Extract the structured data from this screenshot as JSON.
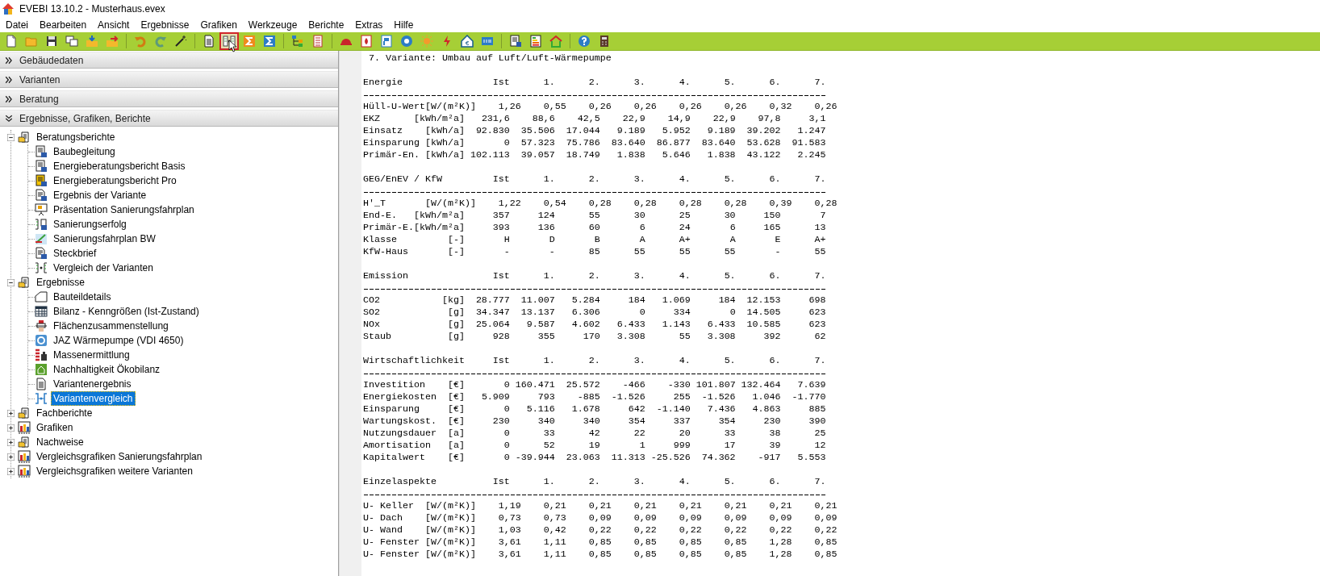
{
  "window": {
    "title": "EVEBI 13.10.2 - Musterhaus.evex"
  },
  "menu": [
    "Datei",
    "Bearbeiten",
    "Ansicht",
    "Ergebnisse",
    "Grafiken",
    "Werkzeuge",
    "Berichte",
    "Extras",
    "Hilfe"
  ],
  "toolbar": [
    {
      "kind": "new",
      "selected": false
    },
    {
      "kind": "open",
      "selected": false
    },
    {
      "kind": "save",
      "selected": false
    },
    {
      "kind": "copy",
      "selected": false
    },
    {
      "kind": "import",
      "selected": false
    },
    {
      "kind": "export",
      "selected": false
    },
    {
      "kind": "sep"
    },
    {
      "kind": "undo",
      "selected": false
    },
    {
      "kind": "redo",
      "selected": false
    },
    {
      "kind": "wand",
      "selected": false
    },
    {
      "kind": "sep"
    },
    {
      "kind": "document",
      "selected": false
    },
    {
      "kind": "compare",
      "selected": true
    },
    {
      "kind": "sigma-orange",
      "selected": false
    },
    {
      "kind": "sigma-blue",
      "selected": false
    },
    {
      "kind": "sep"
    },
    {
      "kind": "tree",
      "selected": false
    },
    {
      "kind": "list",
      "selected": false
    },
    {
      "kind": "sep"
    },
    {
      "kind": "cap",
      "selected": false
    },
    {
      "kind": "flame",
      "selected": false
    },
    {
      "kind": "panel",
      "selected": false
    },
    {
      "kind": "circle",
      "selected": false
    },
    {
      "kind": "sun",
      "selected": false
    },
    {
      "kind": "bolt",
      "selected": false
    },
    {
      "kind": "house-euro",
      "selected": false
    },
    {
      "kind": "box",
      "selected": false
    },
    {
      "kind": "sep"
    },
    {
      "kind": "report",
      "selected": false
    },
    {
      "kind": "energy-label",
      "selected": false
    },
    {
      "kind": "house",
      "selected": false
    },
    {
      "kind": "sep"
    },
    {
      "kind": "help",
      "selected": false
    },
    {
      "kind": "calculator",
      "selected": false
    }
  ],
  "panels": [
    {
      "title": "Gebäudedaten",
      "expanded": false
    },
    {
      "title": "Varianten",
      "expanded": false
    },
    {
      "title": "Beratung",
      "expanded": false
    },
    {
      "title": "Ergebnisse, Grafiken, Berichte",
      "expanded": true
    }
  ],
  "tree": [
    {
      "label": "Beratungsberichte",
      "kind": "report-folder",
      "expanded": true,
      "selected": false,
      "children": [
        {
          "label": "Baubegleitung",
          "kind": "word-report",
          "selected": false
        },
        {
          "label": "Energieberatungsbericht Basis",
          "kind": "word-report",
          "selected": false
        },
        {
          "label": "Energieberatungsbericht Pro",
          "kind": "word-report-pro",
          "selected": false
        },
        {
          "label": "Ergebnis der Variante",
          "kind": "text-report",
          "selected": false
        },
        {
          "label": "Präsentation Sanierungsfahrplan",
          "kind": "presentation",
          "selected": false
        },
        {
          "label": "Sanierungserfolg",
          "kind": "compare-report",
          "selected": false
        },
        {
          "label": "Sanierungsfahrplan BW",
          "kind": "roadmap",
          "selected": false
        },
        {
          "label": "Steckbrief",
          "kind": "text-report",
          "selected": false
        },
        {
          "label": "Vergleich der Varianten",
          "kind": "compare",
          "selected": false
        }
      ]
    },
    {
      "label": "Ergebnisse",
      "kind": "report-folder",
      "expanded": true,
      "selected": false,
      "children": [
        {
          "label": "Bauteildetails",
          "kind": "house-outline",
          "selected": false
        },
        {
          "label": "Bilanz - Kenngrößen (Ist-Zustand)",
          "kind": "grid-table",
          "selected": false
        },
        {
          "label": "Flächenzusammenstellung",
          "kind": "area",
          "selected": false
        },
        {
          "label": "JAZ Wärmepumpe (VDI 4650)",
          "kind": "gauge",
          "selected": false
        },
        {
          "label": "Massenermittlung",
          "kind": "masses",
          "selected": false
        },
        {
          "label": "Nachhaltigkeit Ökobilanz",
          "kind": "eco",
          "selected": false
        },
        {
          "label": "Variantenergebnis",
          "kind": "document",
          "selected": false
        },
        {
          "label": "Variantenvergleich",
          "kind": "compare-blue",
          "selected": true
        }
      ]
    },
    {
      "label": "Fachberichte",
      "kind": "report-folder",
      "expanded": false,
      "selected": false
    },
    {
      "label": "Grafiken",
      "kind": "chart-folder",
      "expanded": false,
      "selected": false
    },
    {
      "label": "Nachweise",
      "kind": "report-folder",
      "expanded": false,
      "selected": false
    },
    {
      "label": "Vergleichsgrafiken Sanierungsfahrplan",
      "kind": "chart-folder",
      "expanded": false,
      "selected": false
    },
    {
      "label": "Vergleichsgrafiken weitere Varianten",
      "kind": "chart-folder",
      "expanded": false,
      "selected": false
    }
  ],
  "report": {
    "title": "7. Variante: Umbau auf Luft/Luft-Wärmepumpe",
    "sections": [
      {
        "title": "Energie",
        "columns": [
          "Ist",
          "1.",
          "2.",
          "3.",
          "4.",
          "5.",
          "6.",
          "7."
        ],
        "rows": [
          {
            "label": "Hüll-U-Wert",
            "unit": "[W/(m²K)]",
            "kind": "decimal",
            "values": [
              "1,26",
              "0,55",
              "0,26",
              "0,26",
              "0,26",
              "0,26",
              "0,32",
              "0,26"
            ]
          },
          {
            "label": "EKZ",
            "unit": "[kWh/m²a]",
            "kind": "standard",
            "values": [
              "231,6",
              "88,6",
              "42,5",
              "22,9",
              "14,9",
              "22,9",
              "97,8",
              "3,1"
            ]
          },
          {
            "label": "Einsatz",
            "unit": "[kWh/a]",
            "kind": "standard",
            "values": [
              "92.830",
              "35.506",
              "17.044",
              "9.189",
              "5.952",
              "9.189",
              "39.202",
              "1.247"
            ]
          },
          {
            "label": "Einsparung",
            "unit": "[kWh/a]",
            "kind": "standard",
            "values": [
              "0",
              "57.323",
              "75.786",
              "83.640",
              "86.877",
              "83.640",
              "53.628",
              "91.583"
            ]
          },
          {
            "label": "Primär-En.",
            "unit": "[kWh/a]",
            "kind": "standard",
            "values": [
              "102.113",
              "39.057",
              "18.749",
              "1.838",
              "5.646",
              "1.838",
              "43.122",
              "2.245"
            ]
          }
        ]
      },
      {
        "title": "GEG/EnEV / KfW",
        "columns": [
          "Ist",
          "1.",
          "2.",
          "3.",
          "4.",
          "5.",
          "6.",
          "7."
        ],
        "rows": [
          {
            "label": "H'_T",
            "unit": "[W/(m²K)]",
            "kind": "decimal",
            "values": [
              "1,22",
              "0,54",
              "0,28",
              "0,28",
              "0,28",
              "0,28",
              "0,39",
              "0,28"
            ]
          },
          {
            "label": "End-E.",
            "unit": "[kWh/m²a]",
            "kind": "standard",
            "values": [
              "357",
              "124",
              "55",
              "30",
              "25",
              "30",
              "150",
              "7"
            ]
          },
          {
            "label": "Primär-E.",
            "unit": "[kWh/m²a]",
            "kind": "standard",
            "values": [
              "393",
              "136",
              "60",
              "6",
              "24",
              "6",
              "165",
              "13"
            ]
          },
          {
            "label": "Klasse",
            "unit": "[-]",
            "kind": "standard",
            "values": [
              "H",
              "D",
              "B",
              "A",
              "A+",
              "A",
              "E",
              "A+"
            ]
          },
          {
            "label": "KfW-Haus",
            "unit": "[-]",
            "kind": "standard",
            "values": [
              "-",
              "-",
              "85",
              "55",
              "55",
              "55",
              "-",
              "55"
            ]
          }
        ]
      },
      {
        "title": "Emission",
        "columns": [
          "Ist",
          "1.",
          "2.",
          "3.",
          "4.",
          "5.",
          "6.",
          "7."
        ],
        "rows": [
          {
            "label": "CO2",
            "unit": "[kg]",
            "kind": "standard",
            "values": [
              "28.777",
              "11.007",
              "5.284",
              "184",
              "1.069",
              "184",
              "12.153",
              "698"
            ]
          },
          {
            "label": "SO2",
            "unit": "[g]",
            "kind": "standard",
            "values": [
              "34.347",
              "13.137",
              "6.306",
              "0",
              "334",
              "0",
              "14.505",
              "623"
            ]
          },
          {
            "label": "NOx",
            "unit": "[g]",
            "kind": "standard",
            "values": [
              "25.064",
              "9.587",
              "4.602",
              "6.433",
              "1.143",
              "6.433",
              "10.585",
              "623"
            ]
          },
          {
            "label": "Staub",
            "unit": "[g]",
            "kind": "standard",
            "values": [
              "928",
              "355",
              "170",
              "3.308",
              "55",
              "3.308",
              "392",
              "62"
            ]
          }
        ]
      },
      {
        "title": "Wirtschaftlichkeit",
        "columns": [
          "Ist",
          "1.",
          "2.",
          "3.",
          "4.",
          "5.",
          "6.",
          "7."
        ],
        "rows": [
          {
            "label": "Investition",
            "unit": "[€]",
            "kind": "standard",
            "values": [
              "0",
              "160.471",
              "25.572",
              "-466",
              "-330",
              "101.807",
              "132.464",
              "7.639"
            ]
          },
          {
            "label": "Energiekosten",
            "unit": "[€]",
            "kind": "standard",
            "values": [
              "5.909",
              "793",
              "-885",
              "-1.526",
              "255",
              "-1.526",
              "1.046",
              "-1.770"
            ]
          },
          {
            "label": "Einsparung",
            "unit": "[€]",
            "kind": "standard",
            "values": [
              "0",
              "5.116",
              "1.678",
              "642",
              "-1.140",
              "7.436",
              "4.863",
              "885"
            ]
          },
          {
            "label": "Wartungskost.",
            "unit": "[€]",
            "kind": "standard",
            "values": [
              "230",
              "340",
              "340",
              "354",
              "337",
              "354",
              "230",
              "390"
            ]
          },
          {
            "label": "Nutzungsdauer",
            "unit": "[a]",
            "kind": "standard",
            "values": [
              "0",
              "33",
              "42",
              "22",
              "20",
              "33",
              "38",
              "25"
            ]
          },
          {
            "label": "Amortisation",
            "unit": "[a]",
            "kind": "standard",
            "values": [
              "0",
              "52",
              "19",
              "1",
              "999",
              "17",
              "39",
              "12"
            ]
          },
          {
            "label": "Kapitalwert",
            "unit": "[€]",
            "kind": "standard",
            "values": [
              "0",
              "-39.944",
              "23.063",
              "11.313",
              "-25.526",
              "74.362",
              "-917",
              "5.553"
            ]
          }
        ]
      },
      {
        "title": "Einzelaspekte",
        "columns": [
          "Ist",
          "1.",
          "2.",
          "3.",
          "4.",
          "5.",
          "6.",
          "7."
        ],
        "rows": [
          {
            "label": "U- Keller",
            "unit": "[W/(m²K)]",
            "kind": "decimal",
            "values": [
              "1,19",
              "0,21",
              "0,21",
              "0,21",
              "0,21",
              "0,21",
              "0,21",
              "0,21"
            ]
          },
          {
            "label": "U- Dach",
            "unit": "[W/(m²K)]",
            "kind": "decimal",
            "values": [
              "0,73",
              "0,73",
              "0,09",
              "0,09",
              "0,09",
              "0,09",
              "0,09",
              "0,09"
            ]
          },
          {
            "label": "U- Wand",
            "unit": "[W/(m²K)]",
            "kind": "decimal",
            "values": [
              "1,03",
              "0,42",
              "0,22",
              "0,22",
              "0,22",
              "0,22",
              "0,22",
              "0,22"
            ]
          },
          {
            "label": "U- Fenster",
            "unit": "[W/(m²K)]",
            "kind": "decimal",
            "values": [
              "3,61",
              "1,11",
              "0,85",
              "0,85",
              "0,85",
              "0,85",
              "1,28",
              "0,85"
            ]
          },
          {
            "label": "U- Fenster",
            "unit": "[W/(m²K)]",
            "kind": "decimal",
            "values": [
              "3,61",
              "1,11",
              "0,85",
              "0,85",
              "0,85",
              "0,85",
              "1,28",
              "0,85"
            ]
          }
        ]
      }
    ]
  }
}
